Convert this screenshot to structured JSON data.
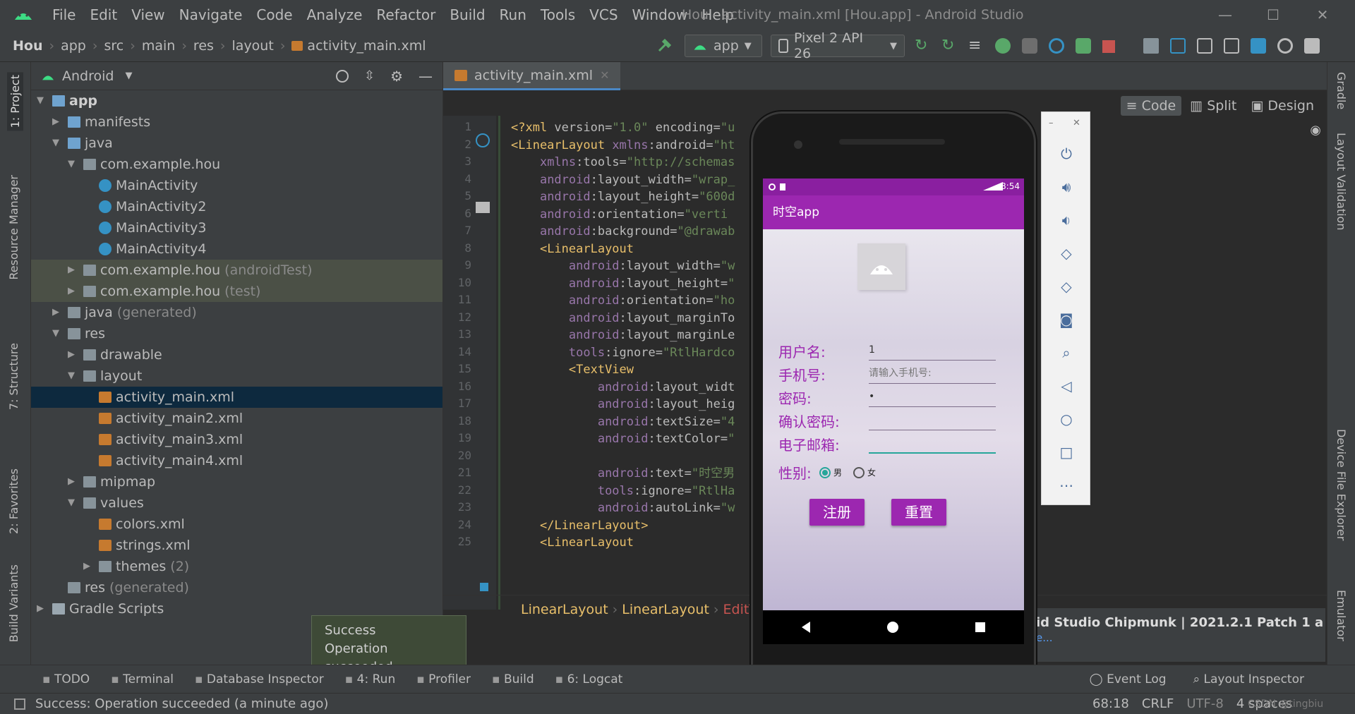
{
  "window": {
    "title": "Hou - activity_main.xml [Hou.app] - Android Studio",
    "menu": [
      "File",
      "Edit",
      "View",
      "Navigate",
      "Code",
      "Analyze",
      "Refactor",
      "Build",
      "Run",
      "Tools",
      "VCS",
      "Window",
      "Help"
    ],
    "controls": {
      "minimize": "—",
      "maximize": "☐",
      "close": "✕"
    }
  },
  "breadcrumb": [
    "Hou",
    "app",
    "src",
    "main",
    "res",
    "layout",
    "activity_main.xml"
  ],
  "toolbar": {
    "run_config": "app",
    "device": "Pixel 2 API 26"
  },
  "left_tabs": [
    "1: Project",
    "Resource Manager",
    "7: Structure",
    "2: Favorites",
    "Build Variants"
  ],
  "right_tabs": [
    "Gradle",
    "Layout Validation",
    "Device File Explorer",
    "Emulator"
  ],
  "project": {
    "view": "Android",
    "tree": [
      {
        "label": "app",
        "depth": 0,
        "icon": "folder-blue",
        "open": true,
        "bold": true
      },
      {
        "label": "manifests",
        "depth": 1,
        "icon": "folder-blue",
        "open": false
      },
      {
        "label": "java",
        "depth": 1,
        "icon": "folder-blue",
        "open": true
      },
      {
        "label": "com.example.hou",
        "depth": 2,
        "icon": "folder",
        "open": true
      },
      {
        "label": "MainActivity",
        "depth": 3,
        "icon": "class"
      },
      {
        "label": "MainActivity2",
        "depth": 3,
        "icon": "class"
      },
      {
        "label": "MainActivity3",
        "depth": 3,
        "icon": "class"
      },
      {
        "label": "MainActivity4",
        "depth": 3,
        "icon": "class"
      },
      {
        "label": "com.example.hou",
        "suffix": "(androidTest)",
        "depth": 2,
        "icon": "folder",
        "open": false,
        "hl": true
      },
      {
        "label": "com.example.hou",
        "suffix": "(test)",
        "depth": 2,
        "icon": "folder",
        "open": false,
        "hl": true
      },
      {
        "label": "java",
        "suffix": "(generated)",
        "depth": 1,
        "icon": "folder-gen",
        "open": false
      },
      {
        "label": "res",
        "depth": 1,
        "icon": "folder",
        "open": true
      },
      {
        "label": "drawable",
        "depth": 2,
        "icon": "folder",
        "open": false
      },
      {
        "label": "layout",
        "depth": 2,
        "icon": "folder",
        "open": true
      },
      {
        "label": "activity_main.xml",
        "depth": 3,
        "icon": "xml",
        "sel": true
      },
      {
        "label": "activity_main2.xml",
        "depth": 3,
        "icon": "xml"
      },
      {
        "label": "activity_main3.xml",
        "depth": 3,
        "icon": "xml"
      },
      {
        "label": "activity_main4.xml",
        "depth": 3,
        "icon": "xml"
      },
      {
        "label": "mipmap",
        "depth": 2,
        "icon": "folder",
        "open": false
      },
      {
        "label": "values",
        "depth": 2,
        "icon": "folder",
        "open": true
      },
      {
        "label": "colors.xml",
        "depth": 3,
        "icon": "xml"
      },
      {
        "label": "strings.xml",
        "depth": 3,
        "icon": "xml"
      },
      {
        "label": "themes",
        "suffix": "(2)",
        "depth": 3,
        "icon": "folder",
        "open": false
      },
      {
        "label": "res",
        "suffix": "(generated)",
        "depth": 1,
        "icon": "folder-gen"
      },
      {
        "label": "Gradle Scripts",
        "depth": 0,
        "icon": "gradle",
        "open": false
      }
    ]
  },
  "editor": {
    "tab": "activity_main.xml",
    "modes": [
      "Code",
      "Split",
      "Design"
    ],
    "lines": [
      {
        "n": "1",
        "t": "<?xml version=\"1.0\" encoding=\"u"
      },
      {
        "n": "2",
        "t": "<LinearLayout xmlns:android=\"ht"
      },
      {
        "n": "3",
        "t": "    xmlns:tools=\"http://schemas"
      },
      {
        "n": "4",
        "t": "    android:layout_width=\"wrap_"
      },
      {
        "n": "5",
        "t": "    android:layout_height=\"600d"
      },
      {
        "n": "6",
        "t": "    android:orientation=\"verti"
      },
      {
        "n": "7",
        "t": "    android:background=\"@drawab"
      },
      {
        "n": "8",
        "t": "    <LinearLayout"
      },
      {
        "n": "9",
        "t": "        android:layout_width=\"w"
      },
      {
        "n": "10",
        "t": "        android:layout_height=\""
      },
      {
        "n": "11",
        "t": "        android:orientation=\"ho"
      },
      {
        "n": "12",
        "t": "        android:layout_marginTo"
      },
      {
        "n": "13",
        "t": "        android:layout_marginLe"
      },
      {
        "n": "14",
        "t": "        tools:ignore=\"RtlHardco"
      },
      {
        "n": "15",
        "t": "        <TextView"
      },
      {
        "n": "16",
        "t": "            android:layout_widt"
      },
      {
        "n": "17",
        "t": "            android:layout_heig"
      },
      {
        "n": "18",
        "t": "            android:textSize=\"4"
      },
      {
        "n": "19",
        "t": "            android:textColor=\""
      },
      {
        "n": "20",
        "t": ""
      },
      {
        "n": "21",
        "t": "            android:text=\"时空男"
      },
      {
        "n": "22",
        "t": "            tools:ignore=\"RtlHa"
      },
      {
        "n": "23",
        "t": "            android:autoLink=\"w"
      },
      {
        "n": "24",
        "t": "    </LinearLayout>"
      },
      {
        "n": "25",
        "t": "    <LinearLayout"
      }
    ],
    "path": [
      "LinearLayout",
      "LinearLayout",
      "EditT"
    ]
  },
  "emulator": {
    "time": "8:54",
    "app_title": "时空app",
    "fields": [
      {
        "label": "用户名:",
        "value": "1",
        "placeholder": ""
      },
      {
        "label": "手机号:",
        "value": "",
        "placeholder": "请输入手机号:"
      },
      {
        "label": "密码:",
        "value": "•",
        "placeholder": ""
      },
      {
        "label": "确认密码:",
        "value": "",
        "placeholder": ""
      },
      {
        "label": "电子邮箱:",
        "value": "",
        "placeholder": "",
        "active": true
      }
    ],
    "gender_label": "性别:",
    "gender_options": [
      "男",
      "女"
    ],
    "buttons": {
      "register": "注册",
      "reset": "重置"
    },
    "colors": {
      "primary": "#9c27b0",
      "status": "#8a1fa0",
      "accent": "#26a69a"
    }
  },
  "notification": {
    "text": "id Studio Chipmunk | 2021.2.1 Patch 1 a",
    "link": "e..."
  },
  "toast": {
    "title": "Success",
    "body": "Operation succeeded"
  },
  "bottom_tools": [
    {
      "label": "TODO",
      "icon": "list-icon"
    },
    {
      "label": "Terminal",
      "icon": "terminal-icon"
    },
    {
      "label": "Database Inspector",
      "icon": "database-icon"
    },
    {
      "label": "4: Run",
      "icon": "run-icon"
    },
    {
      "label": "Profiler",
      "icon": "profiler-icon"
    },
    {
      "label": "Build",
      "icon": "hammer-icon"
    },
    {
      "label": "6: Logcat",
      "icon": "logcat-icon"
    }
  ],
  "bottom_right_tools": [
    {
      "label": "Event Log"
    },
    {
      "label": "Layout Inspector"
    }
  ],
  "status": {
    "message": "Success: Operation succeeded (a minute ago)",
    "position": "68:18",
    "line_sep": "CRLF",
    "encoding": "UTF-8",
    "indent": "4 spaces",
    "watermark": "CSDN @tingbiu"
  }
}
